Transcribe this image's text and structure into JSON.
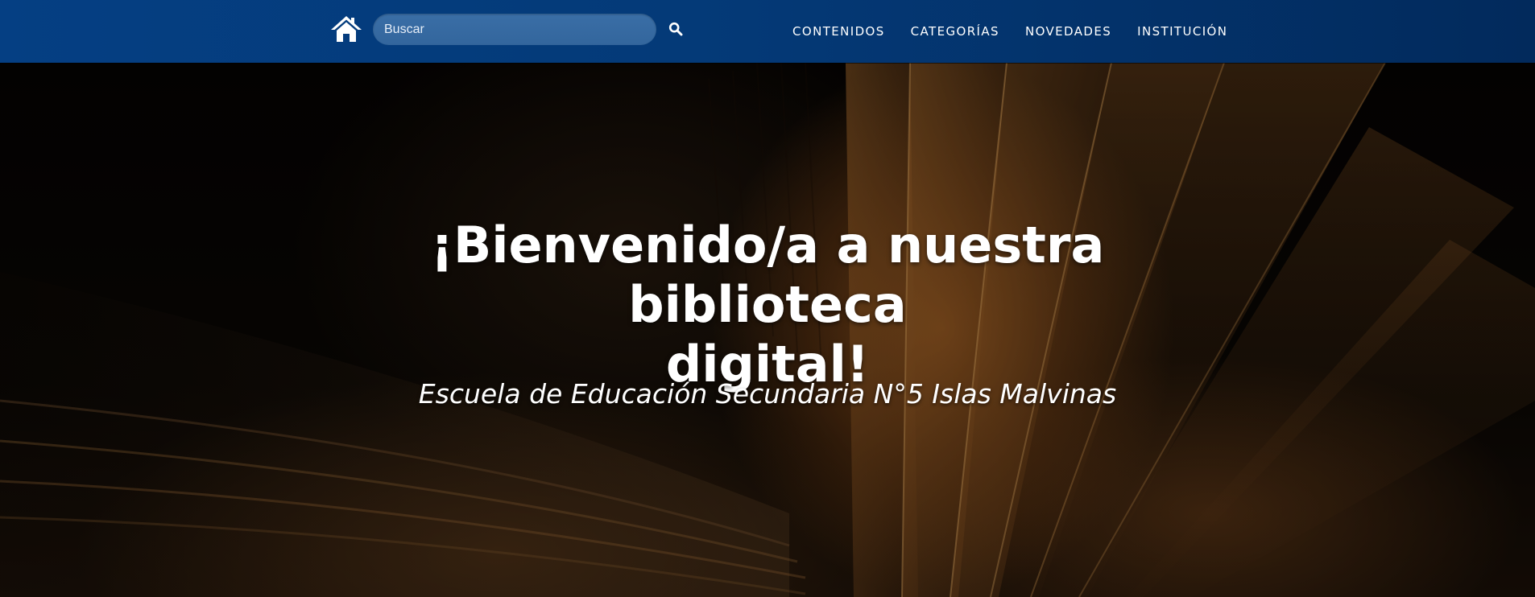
{
  "header": {
    "home_icon": "home-icon",
    "search": {
      "placeholder": "Buscar",
      "value": "",
      "button_icon": "search-icon"
    },
    "nav": [
      {
        "label": "CONTENIDOS"
      },
      {
        "label": "CATEGORÍAS"
      },
      {
        "label": "NOVEDADES"
      },
      {
        "label": "INSTITUCIÓN"
      }
    ]
  },
  "hero": {
    "title_line1": "¡Bienvenido/a a nuestra biblioteca",
    "title_line2": "digital!",
    "subtitle": "Escuela de Educación Secundaria N°5 Islas Malvinas",
    "background": "open-book-image"
  },
  "colors": {
    "navbar": "#043a78",
    "search_field": "#3a6ea6",
    "text": "#ffffff"
  }
}
